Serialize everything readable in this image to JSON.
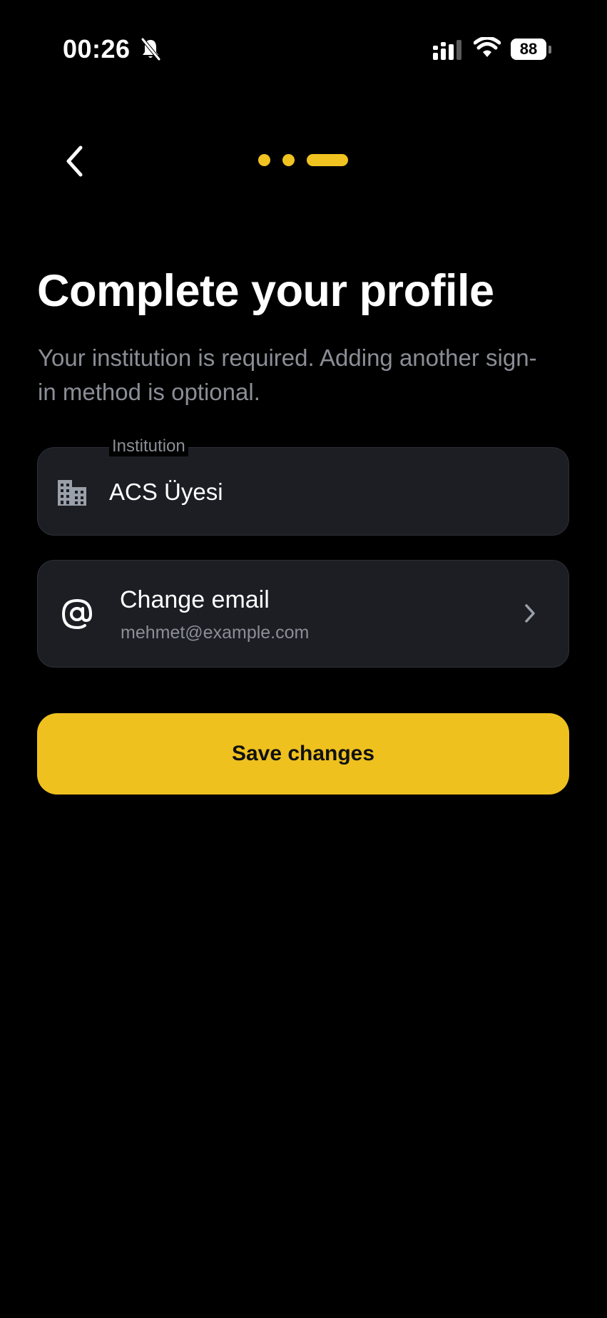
{
  "status_bar": {
    "time": "00:26",
    "battery": "88",
    "icons": [
      "bell-mute-icon",
      "cellular-signal-icon",
      "wifi-icon",
      "battery-icon"
    ]
  },
  "navigation": {
    "back_icon": "chevron-left-icon",
    "progress": {
      "total_steps": 3,
      "current_step": 3
    }
  },
  "header": {
    "title": "Complete your profile",
    "subtitle": "Your institution is required. Adding another sign-in method is optional."
  },
  "institution_field": {
    "label": "Institution",
    "value": "ACS Üyesi",
    "icon": "building-icon"
  },
  "email_row": {
    "title": "Change email",
    "value": "mehmet@example.com",
    "icon": "at-icon",
    "trailing_icon": "chevron-right-icon"
  },
  "actions": {
    "save_label": "Save changes"
  },
  "colors": {
    "background": "#000000",
    "accent": "#efc11f",
    "card": "#1c1e24",
    "muted_text": "#8b8e96"
  }
}
